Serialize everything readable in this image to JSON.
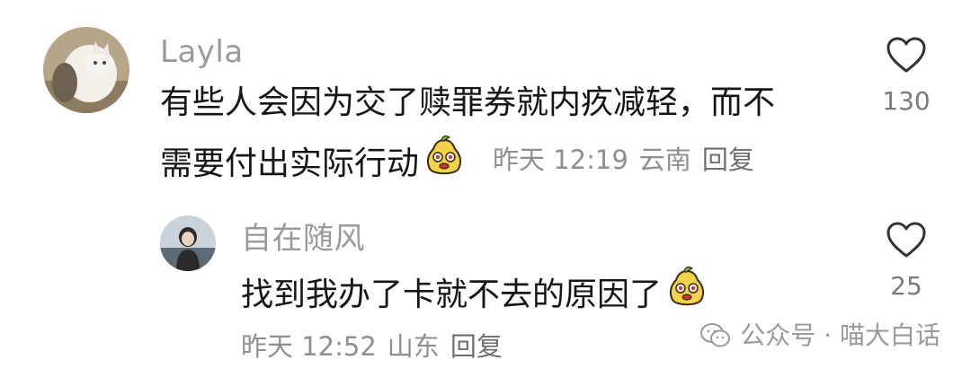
{
  "comments": [
    {
      "username": "Layla",
      "text_line1": "有些人会因为交了赎罪券就内疚减轻，而不",
      "text_line2": "需要付出实际行动",
      "time": "昨天 12:19",
      "location": "云南",
      "reply_label": "回复",
      "like_count": "130",
      "avatar_icon": "cat-photo-avatar",
      "sticker_icon": "pear-face-sticker"
    },
    {
      "username": "自在随风",
      "text_line1": "找到我办了卡就不去的原因了",
      "time": "昨天 12:52",
      "location": "山东",
      "reply_label": "回复",
      "like_count": "25",
      "avatar_icon": "person-photo-avatar",
      "sticker_icon": "pear-face-sticker"
    }
  ],
  "watermark": {
    "text": "公众号 · 喵大白话",
    "icon": "wechat-icon"
  },
  "colors": {
    "text": "#161616",
    "meta": "#8f8f8f",
    "username": "#9a9a9a"
  }
}
